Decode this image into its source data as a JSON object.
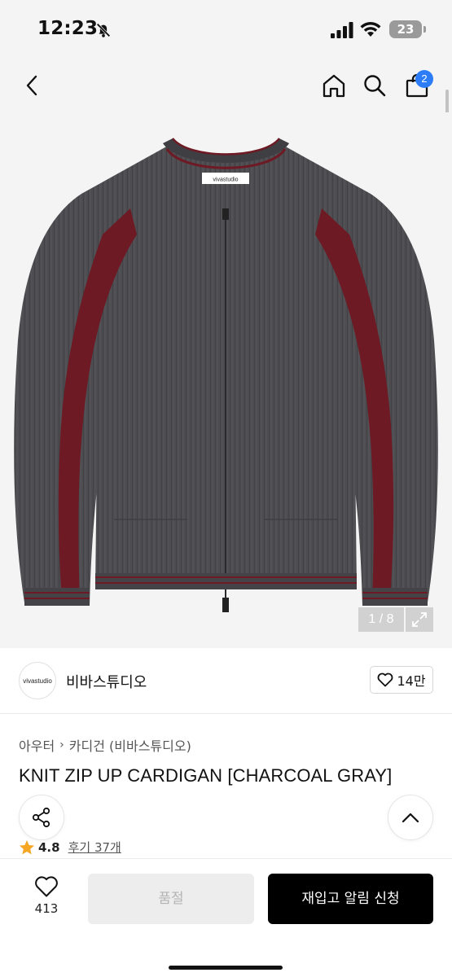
{
  "status_bar": {
    "time": "12:23",
    "battery": "23"
  },
  "header": {
    "cart_count": "2"
  },
  "gallery": {
    "counter": "1 / 8",
    "product_label": "vivastudio"
  },
  "brand": {
    "logo_text": "vivastudio",
    "name": "비바스튜디오",
    "likes": "14만"
  },
  "breadcrumb": {
    "category": "아우터",
    "subcategory": "카디건 (비바스튜디오)"
  },
  "product": {
    "title": "KNIT ZIP UP CARDIGAN [CHARCOAL GRAY]"
  },
  "rating": {
    "value": "4.8",
    "reviews": "후기 37개"
  },
  "bottom": {
    "wish_count": "413",
    "soldout_label": "품절",
    "restock_label": "재입고 알림 신청"
  },
  "colors": {
    "accent_blue": "#2b7cf6",
    "knit_gray": "#4d4c50",
    "stripe_red": "#6e1a24",
    "star": "#f5a623"
  },
  "icons": [
    "bell-slash-icon",
    "signal-icon",
    "wifi-icon",
    "back-icon",
    "home-icon",
    "search-icon",
    "cart-icon",
    "expand-icon",
    "heart-icon",
    "share-icon",
    "chevron-up-icon",
    "star-icon"
  ]
}
